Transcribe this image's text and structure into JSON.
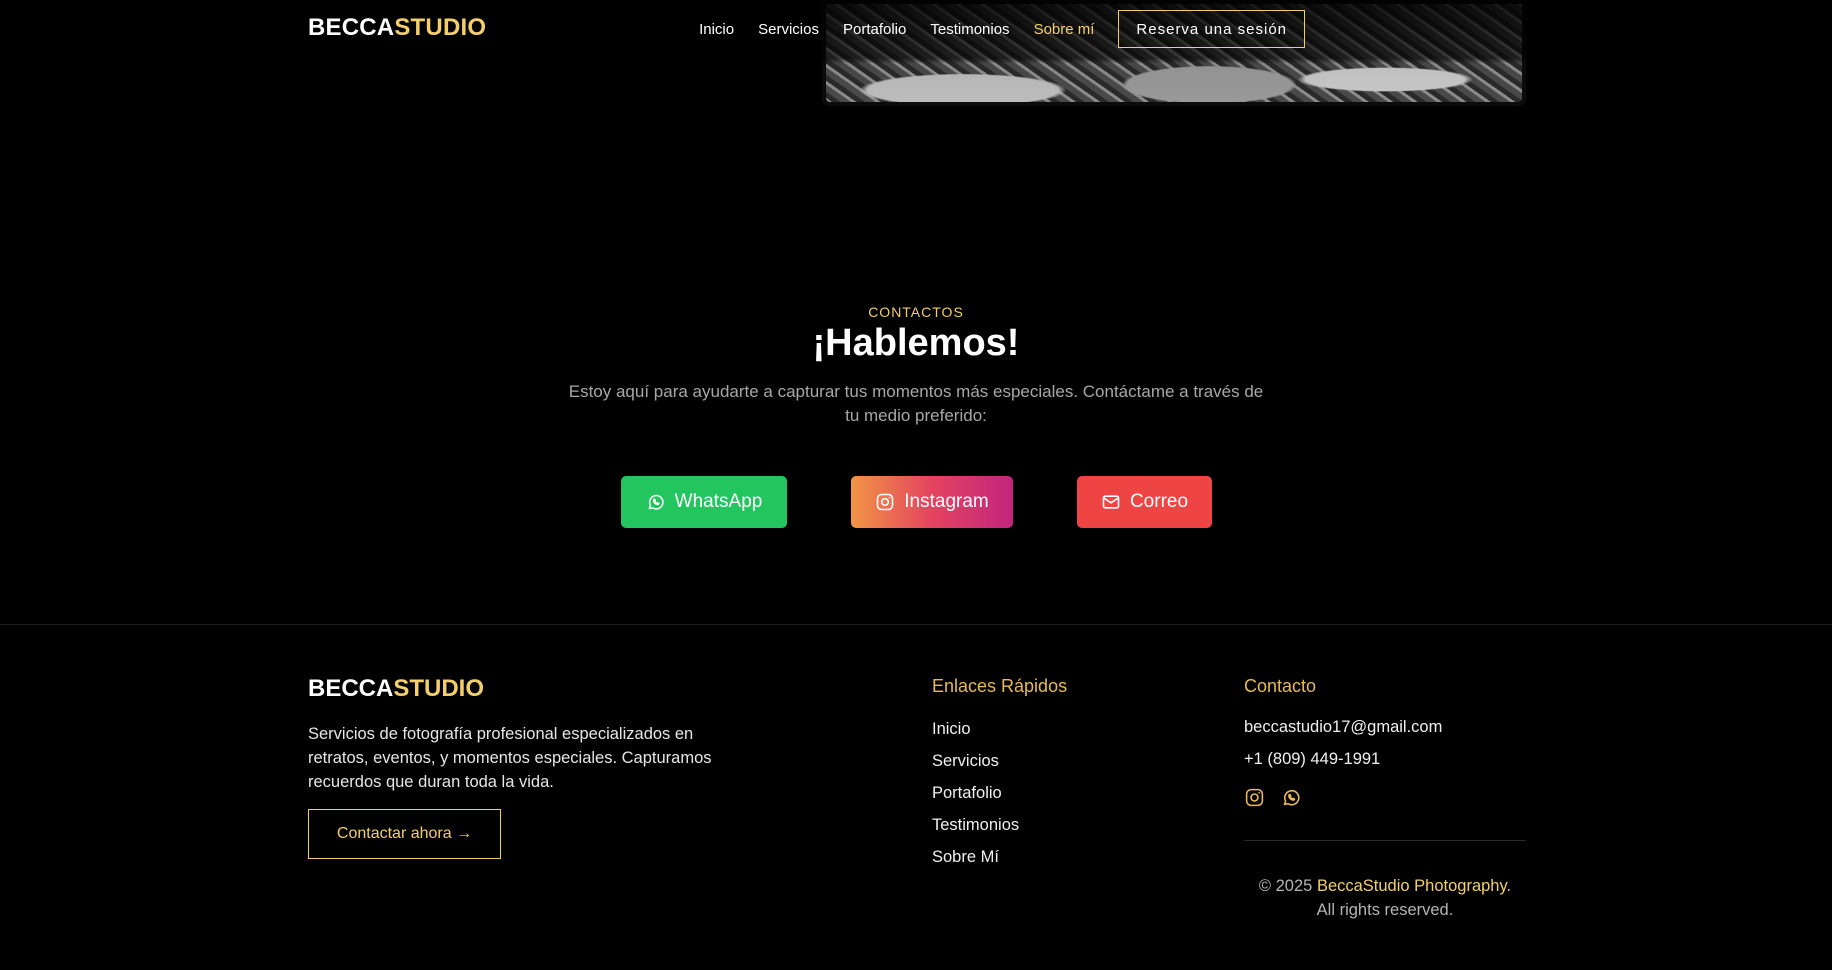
{
  "brand": {
    "part1": "BECCA",
    "part2": "STUDIO",
    "accent_color": "#f3cf6b"
  },
  "nav": {
    "items": [
      "Inicio",
      "Servicios",
      "Portafolio",
      "Testimonios",
      "Sobre mí"
    ],
    "active": "Sobre mí",
    "reserve_label": "Reserva una sesión"
  },
  "contact": {
    "eyebrow": "CONTACTOS",
    "title": "¡Hablemos!",
    "description": "Estoy aquí para ayudarte a capturar tus momentos más especiales. Contáctame a través de tu medio preferido:",
    "buttons": [
      {
        "label": "WhatsApp",
        "icon": "whatsapp-icon",
        "color": "#22c55e"
      },
      {
        "label": "Instagram",
        "icon": "instagram-icon",
        "color": "#e4435f"
      },
      {
        "label": "Correo",
        "icon": "mail-icon",
        "color": "#ef4444"
      }
    ]
  },
  "footer": {
    "description": "Servicios de fotografía profesional especializados en retratos, eventos, y momentos especiales. Capturamos recuerdos que duran toda la vida.",
    "cta_label": "Contactar ahora →",
    "links_title": "Enlaces Rápidos",
    "links": [
      "Inicio",
      "Servicios",
      "Portafolio",
      "Testimonios",
      "Sobre Mí"
    ],
    "contact_title": "Contacto",
    "email": "beccastudio17@gmail.com",
    "phone": "+1 (809) 449-1991",
    "copyright_prefix": "© 2025",
    "copyright_brand": "BeccaStudio Photography.",
    "copyright_suffix": "All rights reserved."
  }
}
